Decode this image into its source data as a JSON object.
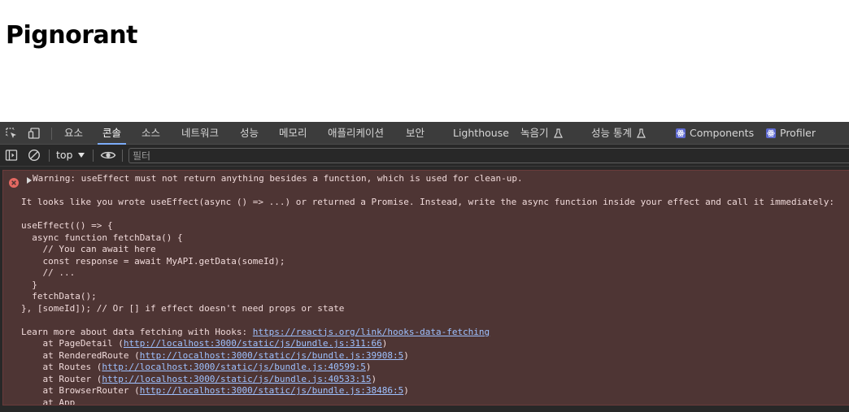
{
  "page": {
    "heading": "Pignorant"
  },
  "devtools": {
    "tabs": [
      {
        "label": "요소",
        "active": false
      },
      {
        "label": "콘솔",
        "active": true
      },
      {
        "label": "소스",
        "active": false
      },
      {
        "label": "네트워크",
        "active": false
      },
      {
        "label": "성능",
        "active": false
      },
      {
        "label": "메모리",
        "active": false
      },
      {
        "label": "애플리케이션",
        "active": false
      },
      {
        "label": "보안",
        "active": false
      },
      {
        "label": "Lighthouse",
        "active": false
      },
      {
        "label": "녹음기",
        "active": false,
        "icon": "flask-icon"
      },
      {
        "label": "성능 통계",
        "active": false,
        "icon": "flask-icon"
      },
      {
        "label": "Components",
        "active": false,
        "icon": "react-icon"
      },
      {
        "label": "Profiler",
        "active": false,
        "icon": "react-icon"
      }
    ],
    "toolbar_icons": [
      "inspect-element-icon",
      "device-toolbar-icon",
      "sidebar-toggle-icon",
      "clear-console-icon",
      "eye-icon"
    ],
    "context_selector": "top",
    "filter": {
      "value": "",
      "placeholder": "필터"
    },
    "colors": {
      "accent": "#7cacf8",
      "error_bg": "#4e3534",
      "error_icon": "#e46962",
      "link": "#9ec1ff"
    }
  },
  "console": {
    "error": {
      "line1": "Warning: useEffect must not return anything besides a function, which is used for clean-up.",
      "line2": "It looks like you wrote useEffect(async () => ...) or returned a Promise. Instead, write the async function inside your effect and call it immediately:",
      "code": [
        "useEffect(() => {",
        "  async function fetchData() {",
        "    // You can await here",
        "    const response = await MyAPI.getData(someId);",
        "    // ...",
        "  }",
        "  fetchData();",
        "}, [someId]); // Or [] if effect doesn't need props or state"
      ],
      "learn_more_prefix": "Learn more about data fetching with Hooks: ",
      "learn_more_link": "https://reactjs.org/link/hooks-data-fetching",
      "stack": [
        {
          "fn": "PageDetail",
          "url": "http://localhost:3000/static/js/bundle.js:311:66"
        },
        {
          "fn": "RenderedRoute",
          "url": "http://localhost:3000/static/js/bundle.js:39908:5"
        },
        {
          "fn": "Routes",
          "url": "http://localhost:3000/static/js/bundle.js:40599:5"
        },
        {
          "fn": "Router",
          "url": "http://localhost:3000/static/js/bundle.js:40533:15"
        },
        {
          "fn": "BrowserRouter",
          "url": "http://localhost:3000/static/js/bundle.js:38486:5"
        },
        {
          "fn": "App",
          "url": ""
        }
      ]
    }
  }
}
